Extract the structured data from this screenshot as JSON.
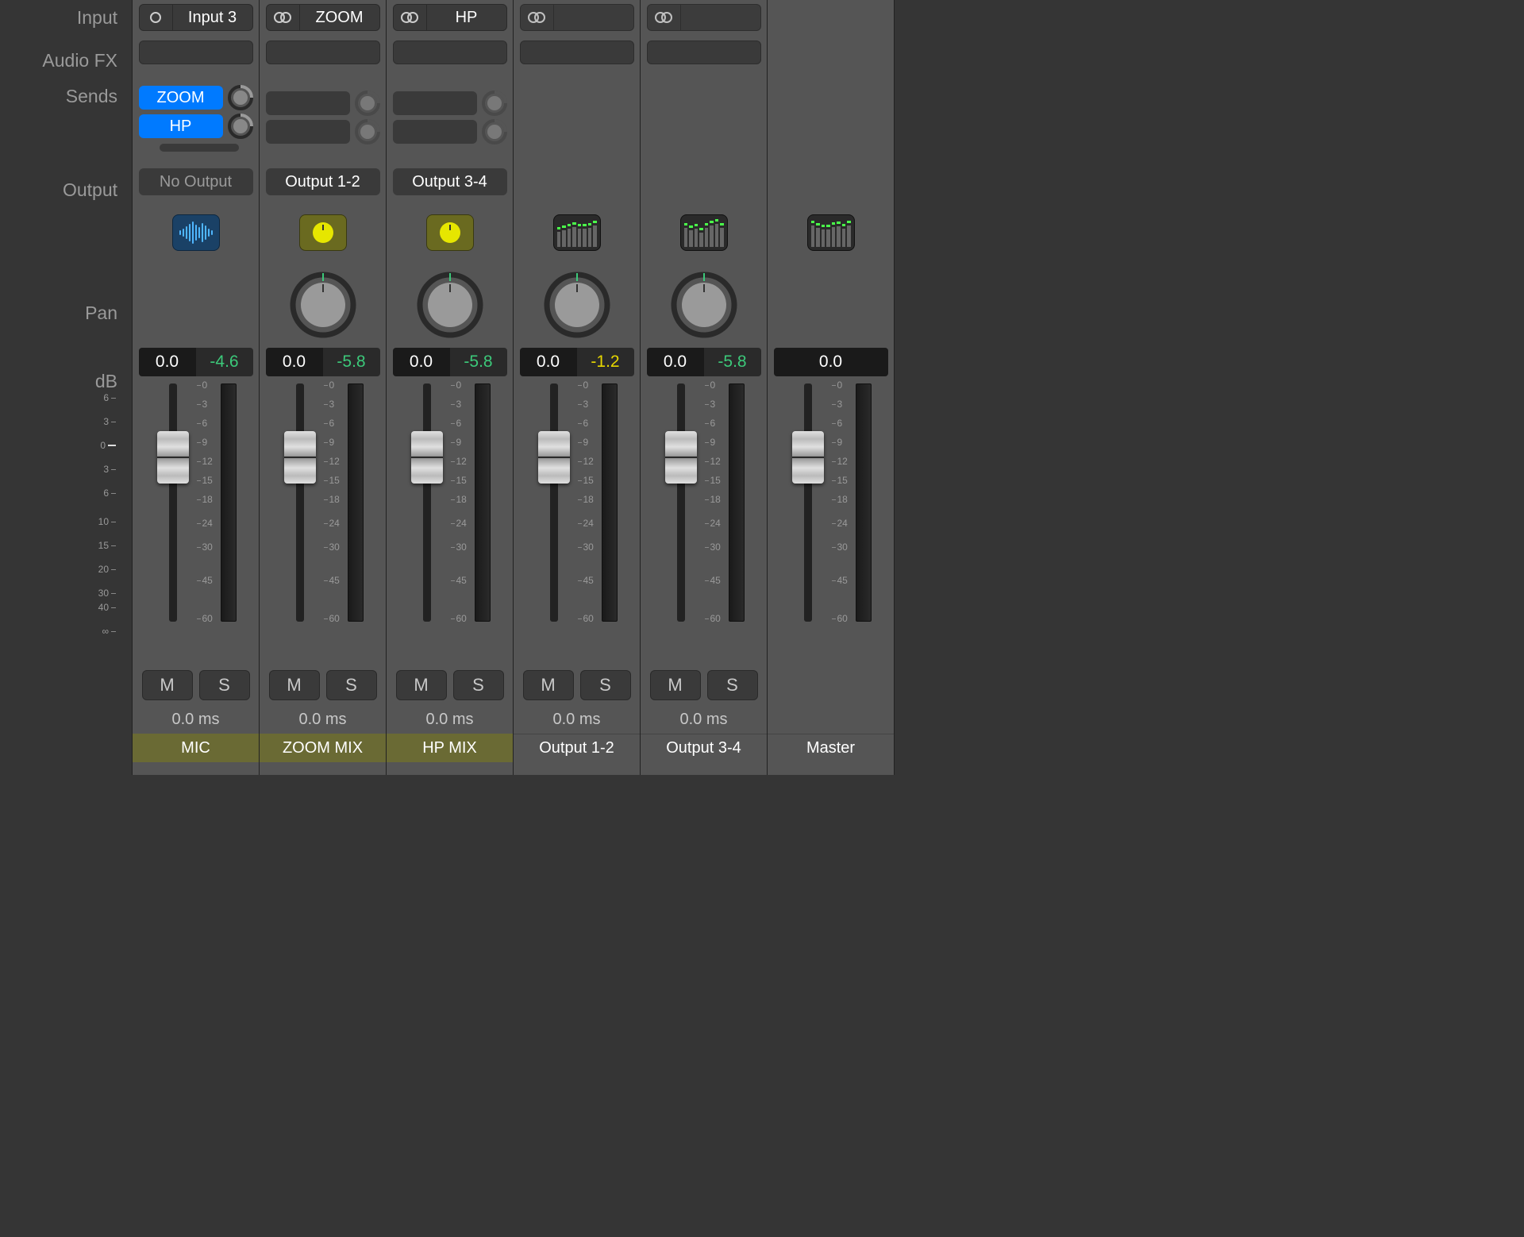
{
  "labels": {
    "input": "Input",
    "audiofx": "Audio FX",
    "sends": "Sends",
    "output": "Output",
    "pan": "Pan",
    "db": "dB"
  },
  "fader_scale_left": [
    "6",
    "3",
    "0",
    "3",
    "6",
    "10",
    "15",
    "20",
    "30",
    "40",
    "∞"
  ],
  "fader_scale_right": [
    "0",
    "3",
    "6",
    "9",
    "12",
    "15",
    "18",
    "24",
    "30",
    "45",
    "60"
  ],
  "channels": [
    {
      "id": "mic",
      "input_mode": "mono",
      "input_name": "Input 3",
      "sends": [
        {
          "label": "ZOOM",
          "type": "blue"
        },
        {
          "label": "HP",
          "type": "blue"
        }
      ],
      "extra_send_stub": true,
      "output": "No Output",
      "output_dim": true,
      "icon": "wave",
      "has_pan": false,
      "db_value": "0.0",
      "peak": "-4.6",
      "peak_color": "green",
      "mute": "M",
      "solo": "S",
      "delay": "0.0 ms",
      "name": "MIC",
      "highlight": true
    },
    {
      "id": "zoommix",
      "input_mode": "stereo",
      "input_name": "ZOOM",
      "sends": [
        {
          "label": "",
          "type": "dark"
        },
        {
          "label": "",
          "type": "dark"
        }
      ],
      "output": "Output 1-2",
      "output_dim": false,
      "icon": "pan",
      "has_pan": true,
      "db_value": "0.0",
      "peak": "-5.8",
      "peak_color": "green",
      "mute": "M",
      "solo": "S",
      "delay": "0.0 ms",
      "name": "ZOOM MIX",
      "highlight": true
    },
    {
      "id": "hpmix",
      "input_mode": "stereo",
      "input_name": "HP",
      "sends": [
        {
          "label": "",
          "type": "dark"
        },
        {
          "label": "",
          "type": "dark"
        }
      ],
      "output": "Output 3-4",
      "output_dim": false,
      "icon": "pan",
      "has_pan": true,
      "db_value": "0.0",
      "peak": "-5.8",
      "peak_color": "green",
      "mute": "M",
      "solo": "S",
      "delay": "0.0 ms",
      "name": "HP MIX",
      "highlight": true
    },
    {
      "id": "out12",
      "input_mode": "stereo",
      "input_name": "",
      "no_sends": true,
      "no_output": true,
      "icon": "mixer",
      "has_pan": true,
      "db_value": "0.0",
      "peak": "-1.2",
      "peak_color": "yellow",
      "mute": "M",
      "solo": "S",
      "delay": "0.0 ms",
      "name": "Output 1-2",
      "highlight": false
    },
    {
      "id": "out34",
      "input_mode": "stereo",
      "input_name": "",
      "no_sends": true,
      "no_output": true,
      "icon": "mixer",
      "has_pan": true,
      "db_value": "0.0",
      "peak": "-5.8",
      "peak_color": "green",
      "mute": "M",
      "solo": "S",
      "delay": "0.0 ms",
      "name": "Output 3-4",
      "highlight": false
    },
    {
      "id": "master",
      "no_input": true,
      "no_fx": true,
      "no_sends": true,
      "no_output": true,
      "icon": "mixer",
      "has_pan": false,
      "db_value": "0.0",
      "peak": "",
      "peak_color": "",
      "single_db": true,
      "no_ms": true,
      "no_delay": true,
      "name": "Master",
      "highlight": false
    }
  ]
}
